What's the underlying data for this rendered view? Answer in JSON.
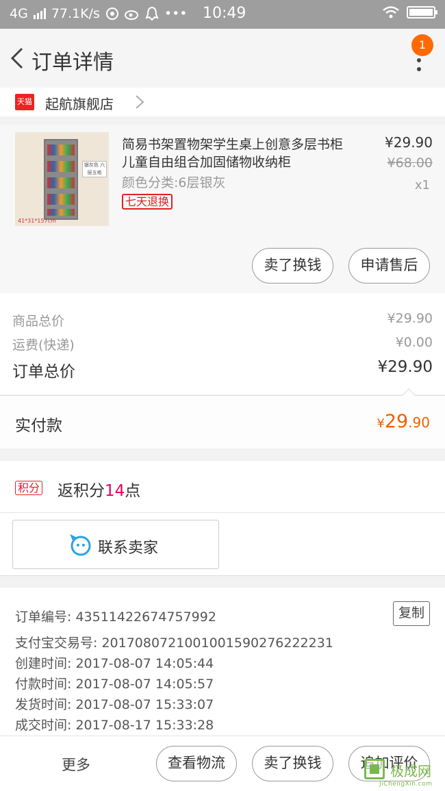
{
  "status_bar": {
    "network": "4G",
    "speed": "77.1K/s",
    "time": "10:49"
  },
  "header": {
    "title": "订单详情",
    "notification_count": "1"
  },
  "shop": {
    "logo_text": "天猫",
    "name": "起航旗舰店"
  },
  "product": {
    "title": "简易书架置物架学生桌上创意多层书柜儿童自由组合加固储物收纳柜",
    "sku": "颜色分类:6层银灰",
    "tag": "七天退换",
    "price": "¥29.90",
    "original_price": "¥68.00",
    "quantity": "x1",
    "image_tag": "银灰色 六层五格",
    "image_dims": "41*31*157cm",
    "buttons": {
      "sell": "卖了换钱",
      "after_sale": "申请售后"
    }
  },
  "summary": {
    "goods_label": "商品总价",
    "goods_value": "¥29.90",
    "shipping_label": "运费(快递)",
    "shipping_value": "¥0.00",
    "total_label": "订单总价",
    "total_value": "¥29.90",
    "paid_label": "实付款",
    "paid_currency": "¥",
    "paid_int": "29",
    "paid_dec": ".90"
  },
  "points": {
    "badge": "积分",
    "prefix": "返积分",
    "value": "14",
    "suffix": "点"
  },
  "contact": {
    "label": "联系卖家"
  },
  "order_info": {
    "copy_label": "复制",
    "lines": [
      "订单编号: 435114226747579​92",
      "支付宝交易号: 2017080721001001590276222231",
      "创建时间: 2017-08-07 14:05:44",
      "付款时间: 2017-08-07 14:05:57",
      "发货时间: 2017-08-07 15:33:07",
      "成交时间: 2017-08-17 15:33:28"
    ]
  },
  "bottom_bar": {
    "more": "更多",
    "logistics": "查看物流",
    "sell": "卖了换钱",
    "review": "追加评价"
  },
  "watermark": {
    "text": "极成网",
    "domain": "JiChengXin.com"
  },
  "colors": {
    "accent_orange": "#f06000",
    "badge_orange": "#ff6a00",
    "tmall_red": "#e22",
    "points_pink": "#e3005c"
  }
}
